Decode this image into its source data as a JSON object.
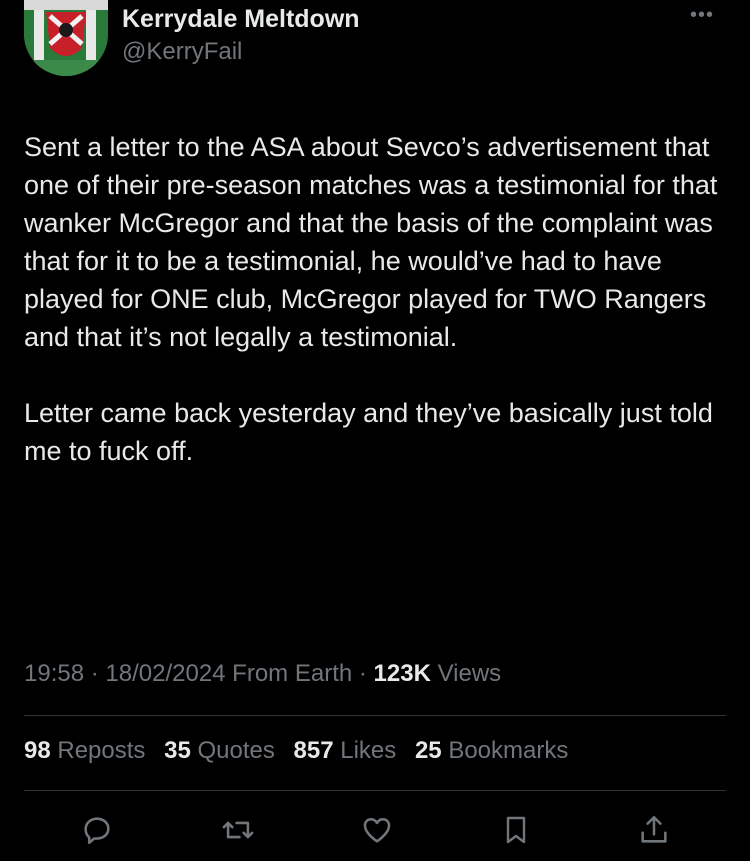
{
  "author": {
    "name": "Kerrydale Meltdown",
    "handle": "@KerryFail"
  },
  "more_label": "•••",
  "tweet": {
    "paragraph1": "Sent a letter to the ASA about Sevco’s advertisement that one of their pre-season matches was a testimonial for that wanker McGregor and that the basis of the complaint was that for it to be a testimonial, he would’ve had to have played for ONE club, McGregor played for TWO Rangers and that it’s not legally a testimonial.",
    "paragraph2": "Letter came back yesterday and they’ve basically just told me to fuck off."
  },
  "meta": {
    "time": "19:58",
    "sep1": " · ",
    "date": "18/02/2024",
    "location": " From Earth",
    "sep2": " · ",
    "views_count": "123K",
    "views_label": " Views"
  },
  "stats": {
    "reposts_count": "98",
    "reposts_label": "Reposts",
    "quotes_count": "35",
    "quotes_label": "Quotes",
    "likes_count": "857",
    "likes_label": "Likes",
    "bookmarks_count": "25",
    "bookmarks_label": "Bookmarks"
  },
  "actions": [
    "reply-icon",
    "repost-icon",
    "like-icon",
    "bookmark-icon",
    "share-icon"
  ],
  "colors": {
    "background": "#000000",
    "text": "#e7e9ea",
    "secondary": "#71767b",
    "divider": "#2f3336"
  }
}
